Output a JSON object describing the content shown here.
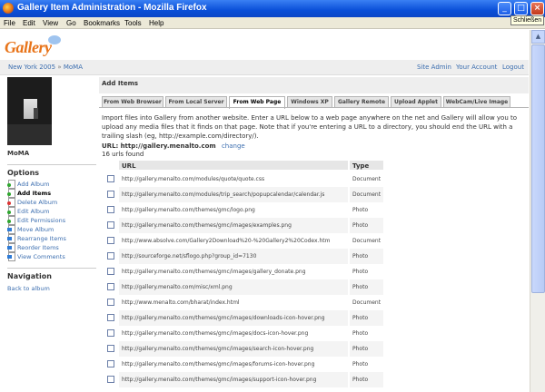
{
  "window": {
    "title": "Gallery Item Administration - Mozilla Firefox",
    "tooltip": "Schließen"
  },
  "menu": [
    "File",
    "Edit",
    "View",
    "Go",
    "Bookmarks",
    "Tools",
    "Help"
  ],
  "logo": {
    "text": "Gallery"
  },
  "breadcrumb": {
    "parent": "New York 2005",
    "separator": "»",
    "current": "MoMA"
  },
  "system_links": [
    "Site Admin",
    "Your Account",
    "Logout"
  ],
  "sidebar": {
    "album_name": "MoMA",
    "options_title": "Options",
    "options": [
      {
        "label": "Add Album",
        "icon": "add-album-icon"
      },
      {
        "label": "Add Items",
        "icon": "add-items-icon"
      },
      {
        "label": "Delete Album",
        "icon": "delete-album-icon"
      },
      {
        "label": "Edit Album",
        "icon": "edit-album-icon"
      },
      {
        "label": "Edit Permissions",
        "icon": "edit-permissions-icon"
      },
      {
        "label": "Move Album",
        "icon": "move-album-icon"
      },
      {
        "label": "Rearrange Items",
        "icon": "rearrange-items-icon"
      },
      {
        "label": "Reorder Items",
        "icon": "reorder-items-icon"
      },
      {
        "label": "View Comments",
        "icon": "view-comments-icon"
      }
    ],
    "navigation_title": "Navigation",
    "back_link": "Back to album"
  },
  "main": {
    "heading": "Add Items",
    "tabs": [
      "From Web Browser",
      "From Local Server",
      "From Web Page",
      "Windows XP",
      "Gallery Remote",
      "Upload Applet",
      "WebCam/Live Image"
    ],
    "active_tab": "From Web Page",
    "description": "Import files into Gallery from another website. Enter a URL below to a web page anywhere on the net and Gallery will allow you to upload any media files that it finds on that page. Note that if you're entering a URL to a directory, you should end the URL with a trailing slash (eg, http://example.com/directory/).",
    "url_label": "URL:",
    "url_value": "http://gallery.menalto.com",
    "change_link": "change",
    "urls_found": "16 urls found",
    "columns": {
      "url": "URL",
      "type": "Type"
    },
    "rows": [
      {
        "url": "http://gallery.menalto.com/modules/quote/quote.css",
        "type": "Document"
      },
      {
        "url": "http://gallery.menalto.com/modules/trip_search/popupcalendar/calendar.js",
        "type": "Document"
      },
      {
        "url": "http://gallery.menalto.com/themes/gmc/logo.png",
        "type": "Photo"
      },
      {
        "url": "http://gallery.menalto.com/themes/gmc/images/examples.png",
        "type": "Photo"
      },
      {
        "url": "http://www.absolve.com/Gallery2Download%20-%20Gallery2%20Codex.htm",
        "type": "Document"
      },
      {
        "url": "http://sourceforge.net/sflogo.php?group_id=7130",
        "type": "Photo"
      },
      {
        "url": "http://gallery.menalto.com/themes/gmc/images/gallery_donate.png",
        "type": "Photo"
      },
      {
        "url": "http://gallery.menalto.com/misc/xml.png",
        "type": "Photo"
      },
      {
        "url": "http://www.menalto.com/bharat/index.html",
        "type": "Document"
      },
      {
        "url": "http://gallery.menalto.com/themes/gmc/images/downloads-icon-hover.png",
        "type": "Photo"
      },
      {
        "url": "http://gallery.menalto.com/themes/gmc/images/docs-icon-hover.png",
        "type": "Photo"
      },
      {
        "url": "http://gallery.menalto.com/themes/gmc/images/search-icon-hover.png",
        "type": "Photo"
      },
      {
        "url": "http://gallery.menalto.com/themes/gmc/images/forums-icon-hover.png",
        "type": "Photo"
      },
      {
        "url": "http://gallery.menalto.com/themes/gmc/images/support-icon-hover.png",
        "type": "Photo"
      }
    ]
  }
}
